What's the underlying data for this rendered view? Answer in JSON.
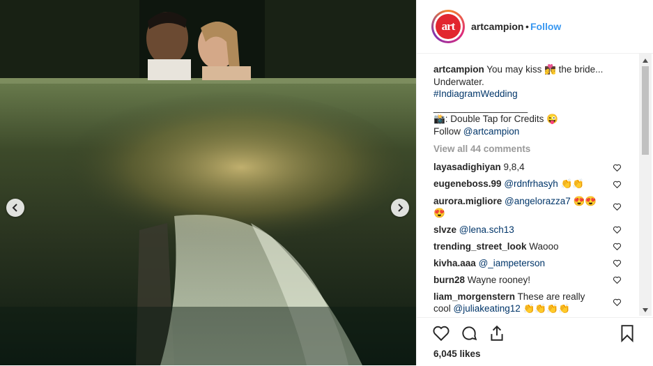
{
  "post": {
    "username": "artcampion",
    "dot": "•",
    "follow_label": "Follow",
    "avatar_text": "art",
    "image_alt": "Couple kissing in a cenote, bride's dress floating underwater"
  },
  "caption": {
    "username": "artcampion",
    "line1": " You may kiss 👩‍❤️‍💋‍👨 the bride...",
    "line2": "Underwater.",
    "hashtag": "#IndiagramWedding",
    "separator": "__________________",
    "credits": "📸: Double Tap for Credits 😜",
    "follow_prefix": "Follow ",
    "follow_mention": "@artcampion"
  },
  "view_all": "View all 44 comments",
  "comments": [
    {
      "user": "layasadighiyan",
      "text": " 9,8,4"
    },
    {
      "user": "eugeneboss.99",
      "mention": "@rdnfrhasyh",
      "text": " 👏👏"
    },
    {
      "user": "aurora.migliore",
      "mention": "@angelorazza7",
      "text": " 😍😍",
      "text2": "😍"
    },
    {
      "user": "slvze",
      "mention": "@lena.sch13",
      "text": ""
    },
    {
      "user": "trending_street_look",
      "text": " Waooo"
    },
    {
      "user": "kivha.aaa",
      "mention": "@_iampeterson",
      "text": ""
    },
    {
      "user": "burn28",
      "text": " Wayne rooney!"
    },
    {
      "user": "liam_morgenstern",
      "text": " These are really",
      "text2_prefix": "cool ",
      "mention2": "@juliakeating12",
      "text2": " 👏👏👏👏"
    }
  ],
  "likes": "6,045 likes",
  "icons": {
    "prev": "chevron-left-icon",
    "next": "chevron-right-icon",
    "like": "heart-icon",
    "comment": "comment-bubble-icon",
    "share": "share-icon",
    "save": "bookmark-icon"
  },
  "colors": {
    "follow": "#3897f0",
    "link": "#003569",
    "muted": "#999999",
    "text": "#262626"
  }
}
